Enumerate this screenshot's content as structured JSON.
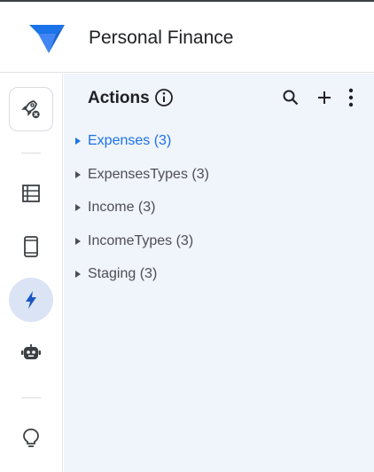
{
  "app": {
    "title": "Personal Finance"
  },
  "rail": {
    "items": [
      {
        "icon": "rocket-icon",
        "label": "Deploy"
      },
      {
        "icon": "table-icon",
        "label": "Data"
      },
      {
        "icon": "phone-icon",
        "label": "App"
      },
      {
        "icon": "bolt-icon",
        "label": "Automation",
        "active": true
      },
      {
        "icon": "robot-icon",
        "label": "Bots"
      },
      {
        "icon": "lightbulb-icon",
        "label": "Insights"
      }
    ]
  },
  "panel": {
    "title": "Actions",
    "tools": [
      "search-icon",
      "add-icon",
      "more-vert-icon"
    ],
    "items": [
      {
        "label": "Expenses (3)",
        "selected": true
      },
      {
        "label": "ExpensesTypes (3)",
        "selected": false
      },
      {
        "label": "Income (3)",
        "selected": false
      },
      {
        "label": "IncomeTypes (3)",
        "selected": false
      },
      {
        "label": "Staging (3)",
        "selected": false
      }
    ]
  },
  "colors": {
    "accent": "#1a73e8",
    "panel_bg": "#f0f4fb",
    "rail_active_bg": "#dbe4f5",
    "text_muted": "#4d4f53"
  }
}
